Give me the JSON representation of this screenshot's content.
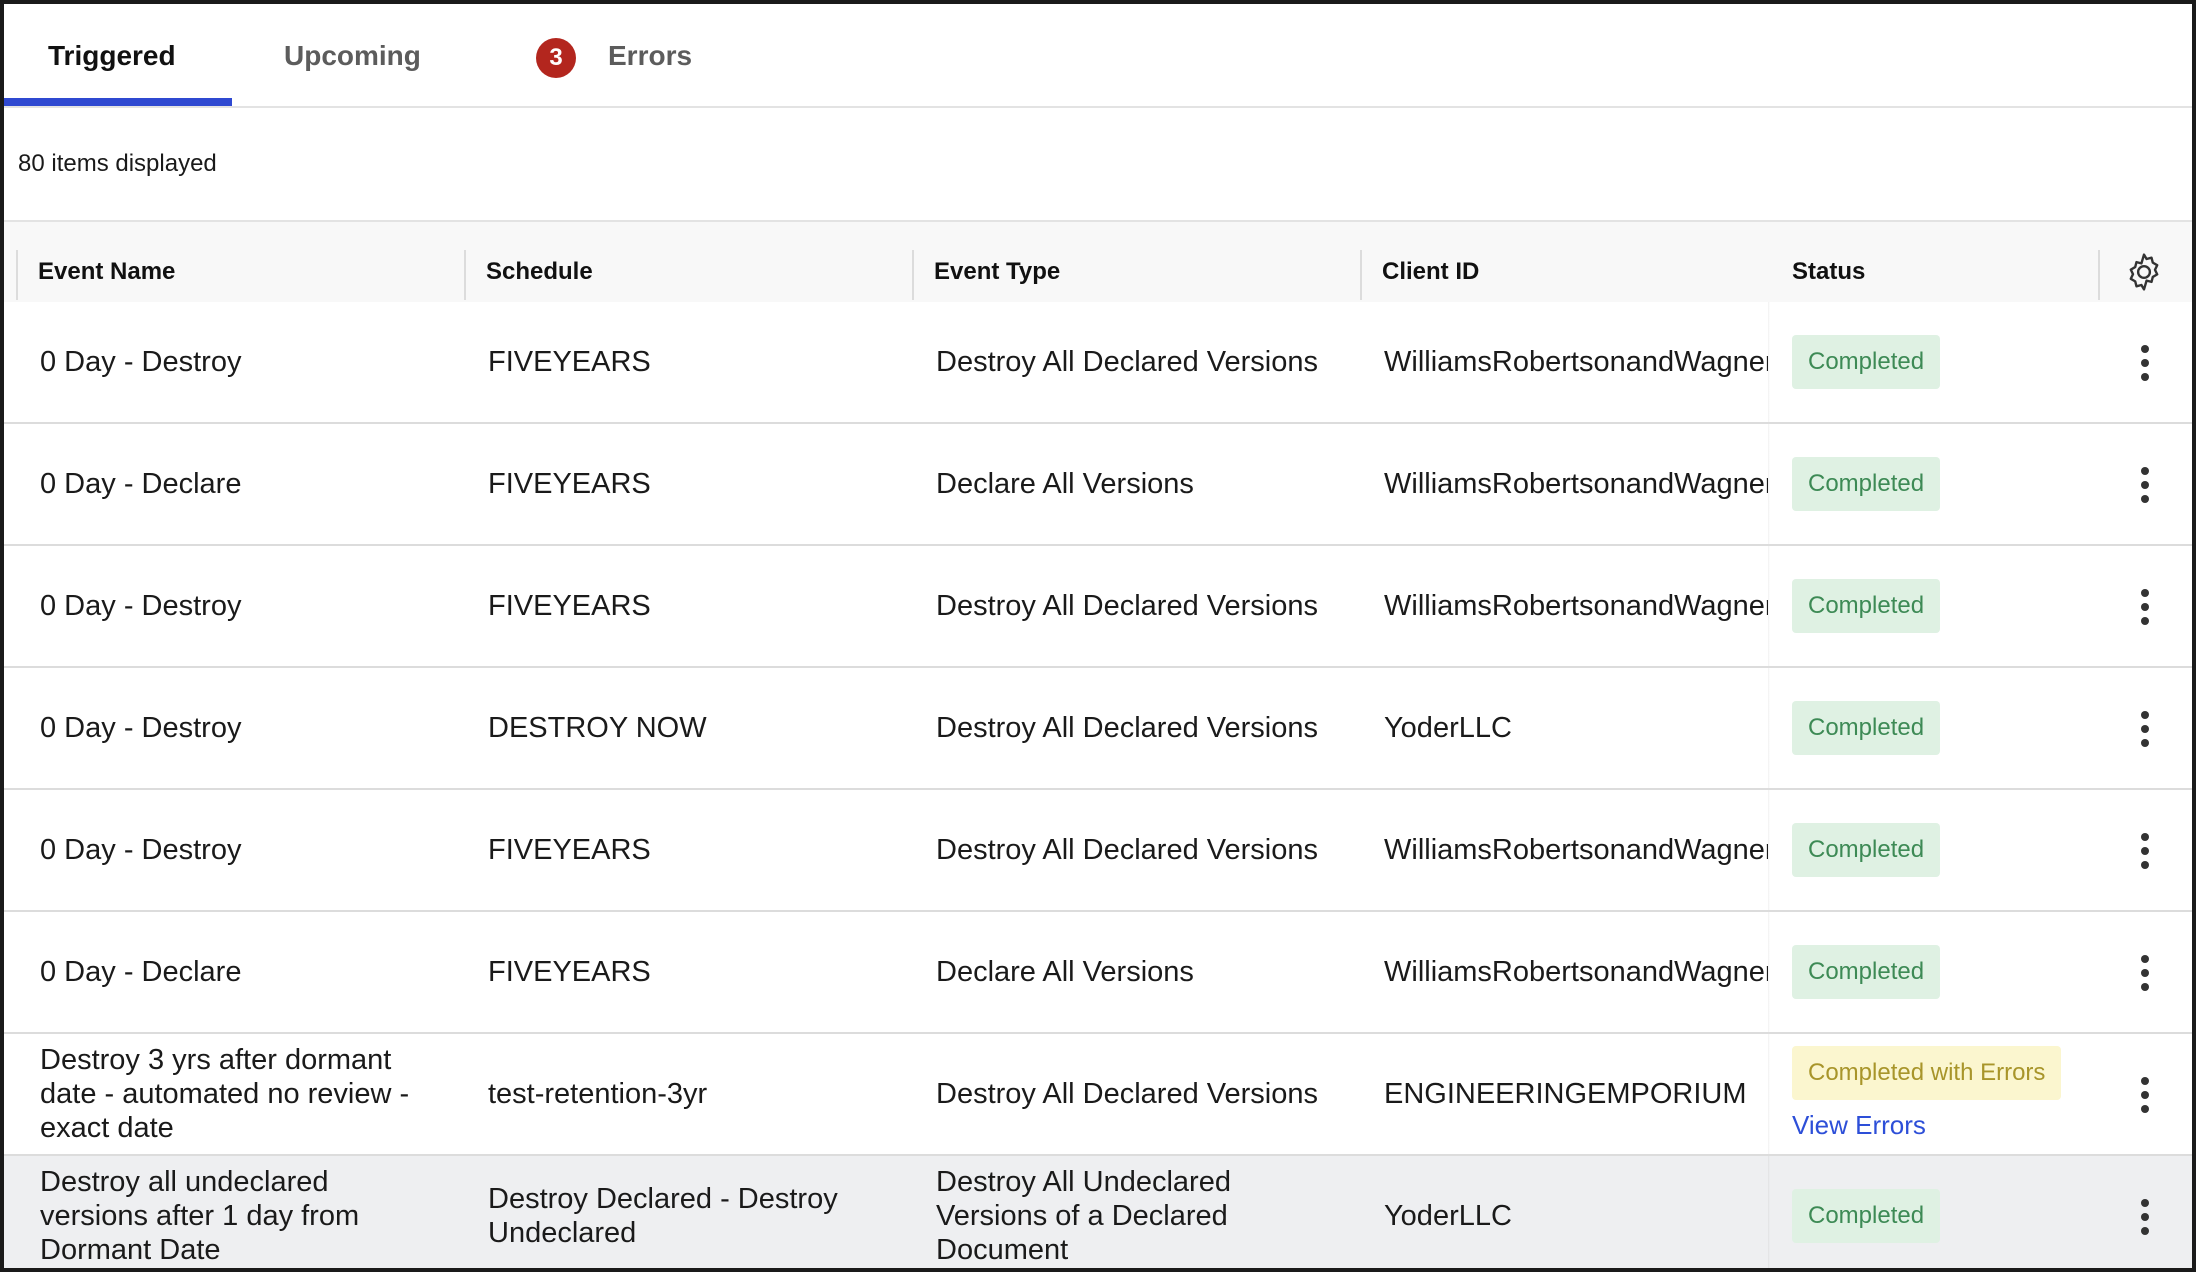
{
  "tabs": [
    {
      "label": "Triggered",
      "active": true
    },
    {
      "label": "Upcoming",
      "active": false
    },
    {
      "label": "Errors",
      "active": false,
      "badge": "3"
    }
  ],
  "summary": {
    "count_text": "80 items displayed"
  },
  "columns": [
    "Event Name",
    "Schedule",
    "Event Type",
    "Client ID",
    "Status"
  ],
  "rows": [
    {
      "event_name": "0 Day - Destroy",
      "schedule": "FIVEYEARS",
      "event_type": "Destroy All Declared Versions",
      "client_id": "WilliamsRobertsonandWagner",
      "status": "Completed"
    },
    {
      "event_name": "0 Day - Declare",
      "schedule": "FIVEYEARS",
      "event_type": "Declare All Versions",
      "client_id": "WilliamsRobertsonandWagner",
      "status": "Completed"
    },
    {
      "event_name": "0 Day - Destroy",
      "schedule": "FIVEYEARS",
      "event_type": "Destroy All Declared Versions",
      "client_id": "WilliamsRobertsonandWagner",
      "status": "Completed"
    },
    {
      "event_name": "0 Day - Destroy",
      "schedule": "DESTROY NOW",
      "event_type": "Destroy All Declared Versions",
      "client_id": "YoderLLC",
      "status": "Completed"
    },
    {
      "event_name": "0 Day - Destroy",
      "schedule": "FIVEYEARS",
      "event_type": "Destroy All Declared Versions",
      "client_id": "WilliamsRobertsonandWagner",
      "status": "Completed"
    },
    {
      "event_name": "0 Day - Declare",
      "schedule": "FIVEYEARS",
      "event_type": "Declare All Versions",
      "client_id": "WilliamsRobertsonandWagner",
      "status": "Completed"
    },
    {
      "event_name": "Destroy 3 yrs after dormant date - automated no review - exact date",
      "schedule": "test-retention-3yr",
      "event_type": "Destroy All Declared Versions",
      "client_id": "ENGINEERINGEMPORIUM",
      "status": "Completed with Errors",
      "link": "View Errors"
    },
    {
      "event_name": "Destroy all undeclared versions after 1 day from Dormant Date",
      "schedule": "Destroy Declared - Destroy Undeclared",
      "event_type": "Destroy All Undeclared Versions of a Declared Document",
      "client_id": "YoderLLC",
      "status": "Completed"
    }
  ],
  "colors": {
    "accent": "#2f49d1",
    "error_badge": "#b3261e",
    "ok_bg": "#dff1e3",
    "ok_text": "#3d8a55",
    "warn_bg": "#fbf6cf",
    "warn_text": "#a8952a",
    "link": "#2d4fd8"
  }
}
